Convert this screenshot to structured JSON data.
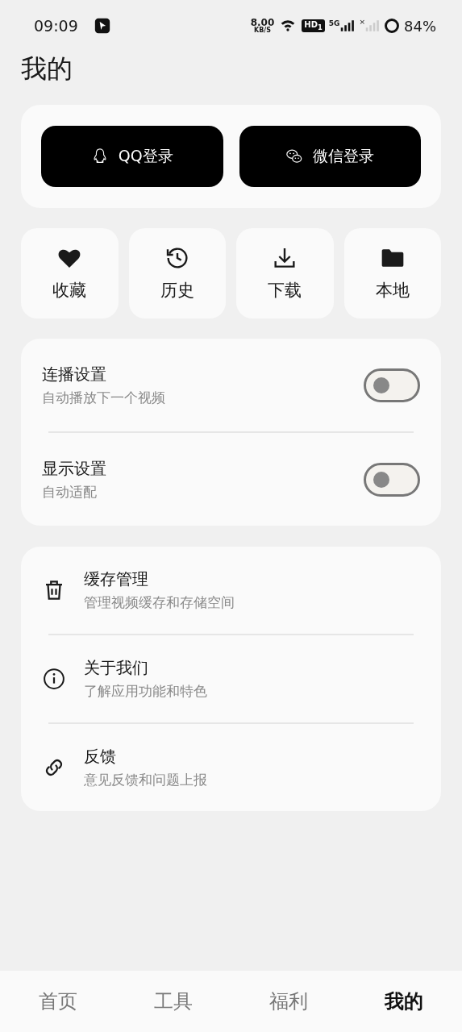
{
  "status_bar": {
    "time": "09:09",
    "net_speed": "8.00",
    "net_unit": "KB/S",
    "hd": "HD$_{1}$",
    "network": "5G",
    "no_sim": "×",
    "battery": "84%"
  },
  "page_title": "我的",
  "login_buttons": [
    {
      "kind": "qq",
      "label": "QQ登录"
    },
    {
      "kind": "wechat",
      "label": "微信登录"
    }
  ],
  "shortcuts": [
    {
      "kind": "heart",
      "label": "收藏"
    },
    {
      "kind": "history",
      "label": "历史"
    },
    {
      "kind": "download",
      "label": "下载"
    },
    {
      "kind": "folder",
      "label": "本地"
    }
  ],
  "settings": [
    {
      "title": "连播设置",
      "subtitle": "自动播放下一个视频",
      "on": false
    },
    {
      "title": "显示设置",
      "subtitle": "自动适配",
      "on": false
    }
  ],
  "menu": [
    {
      "kind": "trash",
      "title": "缓存管理",
      "subtitle": "管理视频缓存和存储空间"
    },
    {
      "kind": "info",
      "title": "关于我们",
      "subtitle": "了解应用功能和特色"
    },
    {
      "kind": "link",
      "title": "反馈",
      "subtitle": "意见反馈和问题上报"
    }
  ],
  "tabs": [
    {
      "label": "首页",
      "selected": false
    },
    {
      "label": "工具",
      "selected": false
    },
    {
      "label": "福利",
      "selected": false
    },
    {
      "label": "我的",
      "selected": true
    }
  ]
}
